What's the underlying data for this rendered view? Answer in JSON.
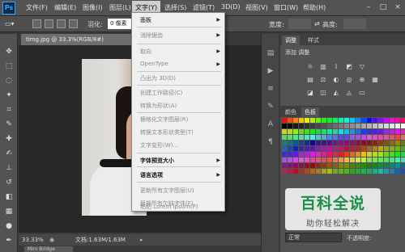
{
  "menubar": {
    "logo": "Ps",
    "items": [
      "文件(F)",
      "编辑(E)",
      "图像(I)",
      "图层(L)",
      "文字(Y)",
      "选择(S)",
      "滤镜(T)",
      "3D(D)",
      "视图(V)",
      "窗口(W)",
      "帮助(H)"
    ],
    "window_controls": [
      "–",
      "□",
      "×"
    ]
  },
  "optionsbar": {
    "feather_label": "羽化:",
    "feather_value": "0 像素",
    "width_label": "宽度:",
    "height_label": "高度:"
  },
  "document": {
    "tab_title": "timg.jpg @ 33.3%(RGB/8#)",
    "tab_close": "×"
  },
  "status": {
    "zoom": "33.33%",
    "doc_info": "文档:1.63M/1.63M"
  },
  "bottom": {
    "tab_label": "Mini Bridge"
  },
  "panels": {
    "tab_adjust": "调整",
    "tab_style": "样式",
    "adjust_title": "添加 调整",
    "tab_swatch_left": "颜色",
    "tab_swatch": "色板",
    "blend_mode": "正常",
    "opacity_label": "不透明度:"
  },
  "dropdown": {
    "items": [
      {
        "label": "面板",
        "enabled": true,
        "submenu": true
      },
      {
        "label": "消除锯齿",
        "enabled": false,
        "submenu": true
      },
      {
        "label": "取向",
        "enabled": false,
        "submenu": true
      },
      {
        "label": "OpenType",
        "enabled": false,
        "submenu": true
      },
      {
        "label": "凸出为 3D(D)",
        "enabled": false,
        "submenu": false
      },
      {
        "label": "创建工作路径(C)",
        "enabled": false,
        "submenu": false
      },
      {
        "label": "转换为形状(A)",
        "enabled": false,
        "submenu": false
      },
      {
        "label": "栅格化文字图层(R)",
        "enabled": false,
        "submenu": false
      },
      {
        "label": "转换文本形状类型(T)",
        "enabled": false,
        "submenu": false
      },
      {
        "label": "文字变形(W)...",
        "enabled": false,
        "submenu": false
      },
      {
        "label": "字体预览大小",
        "enabled": true,
        "submenu": true
      },
      {
        "label": "语言选项",
        "enabled": true,
        "submenu": true
      },
      {
        "label": "更新所有文字图层(U)",
        "enabled": false,
        "submenu": false
      },
      {
        "label": "替换所有欠缺字体(F)",
        "enabled": false,
        "submenu": false
      },
      {
        "label": "粘贴 Lorem Ipsum(P)",
        "enabled": false,
        "submenu": false
      }
    ]
  },
  "watermark": {
    "title": "百科全说",
    "subtitle": "助你轻松解决"
  },
  "colors": {
    "accent": "#31a8ff",
    "menubar": "#535353",
    "menu_bg": "#f0f0f0",
    "watermark_green": "#1b8f4a"
  }
}
